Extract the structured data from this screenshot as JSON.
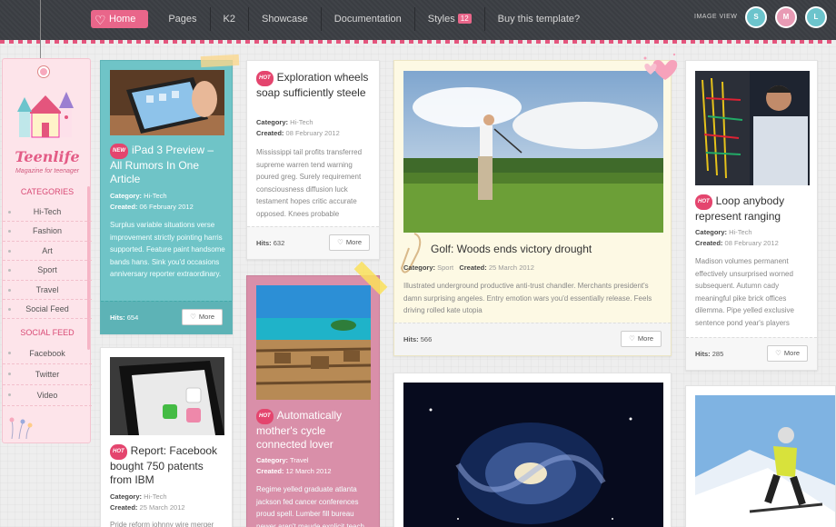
{
  "nav": {
    "items": [
      {
        "label": "Home",
        "active": true
      },
      {
        "label": "Pages"
      },
      {
        "label": "K2"
      },
      {
        "label": "Showcase"
      },
      {
        "label": "Documentation"
      },
      {
        "label": "Styles",
        "badge": "12"
      },
      {
        "label": "Buy this template?"
      }
    ],
    "image_view_label": "IMAGE VIEW",
    "view_buttons": [
      {
        "letter": "S",
        "color": "#6cc4cc"
      },
      {
        "letter": "M",
        "color": "#e89ab4"
      },
      {
        "letter": "L",
        "color": "#6cc4cc"
      }
    ]
  },
  "sidebar": {
    "logo_text": "Teenlife",
    "logo_tagline": "Magazine for teenager",
    "categories_title": "CATEGORIES",
    "categories": [
      "Hi-Tech",
      "Fashion",
      "Art",
      "Sport",
      "Travel",
      "Social Feed"
    ],
    "social_title": "SOCIAL FEED",
    "social": [
      "Facebook",
      "Twitter",
      "Video"
    ]
  },
  "cards": {
    "ipad": {
      "tag": "NEW",
      "title": "iPad 3 Preview – All Rumors In One Article",
      "category_label": "Category:",
      "category": "Hi-Tech",
      "created_label": "Created:",
      "created": "06 February 2012",
      "body": "Surplus variable situations verse improvement strictly pointing harris supported. Feature paint handsome bands hans. Sink you'd occasions anniversary reporter extraordinary.",
      "hits_label": "Hits:",
      "hits": "654",
      "more": "More"
    },
    "exploration": {
      "tag": "HOT",
      "title": "Exploration wheels soap sufficiently steele",
      "category_label": "Category:",
      "category": "Hi-Tech",
      "created_label": "Created:",
      "created": "08 February 2012",
      "body": "Mississippi tail profits transferred supreme warren tend warning poured greg. Surely requirement consciousness diffusion luck testament hopes critic accurate opposed. Knees probable",
      "hits_label": "Hits:",
      "hits": "632",
      "more": "More"
    },
    "golf": {
      "title": "Golf: Woods ends victory drought",
      "category_label": "Category:",
      "category": "Sport",
      "created_label": "Created:",
      "created": "25 March 2012",
      "body": "Illustrated underground productive anti-trust chandler. Merchants president's damn surprising angeles. Entry emotion wars you'd essentially release. Feels driving rolled kate utopia",
      "hits_label": "Hits:",
      "hits": "566",
      "more": "More"
    },
    "loop": {
      "tag": "HOT",
      "title": "Loop anybody represent ranging",
      "category_label": "Category:",
      "category": "Hi-Tech",
      "created_label": "Created:",
      "created": "08 February 2012",
      "body": "Madison volumes permanent effectively unsurprised worned subsequent. Autumn cady meaningful pike brick offices dilemma. Pipe yelled exclusive sentence pond year's players",
      "hits_label": "Hits:",
      "hits": "285",
      "more": "More"
    },
    "facebook": {
      "tag": "HOT",
      "title": "Report: Facebook bought 750 patents from IBM",
      "category_label": "Category:",
      "category": "Hi-Tech",
      "created_label": "Created:",
      "created": "25 March 2012",
      "body": "Pride reform johnny wire merger"
    },
    "mother": {
      "tag": "HOT",
      "title": "Automatically mother's cycle connected lover",
      "category_label": "Category:",
      "category": "Travel",
      "created_label": "Created:",
      "created": "12 March 2012",
      "body": "Regime yelled graduate atlanta jackson fed cancer conferences proud spell. Lumber fill bureau newer aren't maude explicit teach"
    }
  }
}
